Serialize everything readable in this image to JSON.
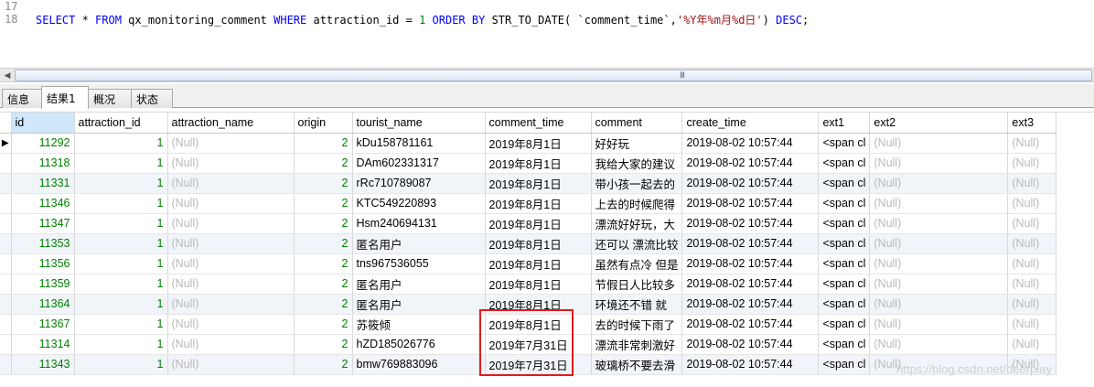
{
  "editor": {
    "line_numbers": [
      "17",
      "18"
    ],
    "sql": {
      "kw_select": "SELECT",
      "star": " * ",
      "kw_from": "FROM",
      "table": " qx_monitoring_comment ",
      "kw_where": "WHERE",
      "cond": " attraction_id = ",
      "value": "1",
      "kw_order": " ORDER BY ",
      "func": "STR_TO_DATE( `comment_time`,",
      "fmt": "'%Y年%m月%d日'",
      "close": ") ",
      "kw_desc": "DESC",
      "semicolon": ";"
    }
  },
  "scrollbar": {
    "grip": "III"
  },
  "tabs": [
    "信息",
    "结果1",
    "概况",
    "状态"
  ],
  "grid": {
    "columns": [
      "id",
      "attraction_id",
      "attraction_name",
      "origin",
      "tourist_name",
      "comment_time",
      "comment",
      "create_time",
      "ext1",
      "ext2",
      "ext3"
    ],
    "rows": [
      [
        "11292",
        "1",
        "(Null)",
        "2",
        "kDu158781161",
        "2019年8月1日",
        "好好玩",
        "2019-08-02 10:57:44",
        "<span cl",
        "(Null)",
        "(Null)"
      ],
      [
        "11318",
        "1",
        "(Null)",
        "2",
        "DAm602331317",
        "2019年8月1日",
        "我给大家的建议",
        "2019-08-02 10:57:44",
        "<span cl",
        "(Null)",
        "(Null)"
      ],
      [
        "11331",
        "1",
        "(Null)",
        "2",
        "rRc710789087",
        "2019年8月1日",
        "带小孩一起去的",
        "2019-08-02 10:57:44",
        "<span cl",
        "(Null)",
        "(Null)"
      ],
      [
        "11346",
        "1",
        "(Null)",
        "2",
        "KTC549220893",
        "2019年8月1日",
        "上去的时候爬得",
        "2019-08-02 10:57:44",
        "<span cl",
        "(Null)",
        "(Null)"
      ],
      [
        "11347",
        "1",
        "(Null)",
        "2",
        "Hsm240694131",
        "2019年8月1日",
        "漂流好好玩，大",
        "2019-08-02 10:57:44",
        "<span cl",
        "(Null)",
        "(Null)"
      ],
      [
        "11353",
        "1",
        "(Null)",
        "2",
        "匿名用户",
        "2019年8月1日",
        "还可以 漂流比较",
        "2019-08-02 10:57:44",
        "<span cl",
        "(Null)",
        "(Null)"
      ],
      [
        "11356",
        "1",
        "(Null)",
        "2",
        "tns967536055",
        "2019年8月1日",
        "虽然有点冷 但是",
        "2019-08-02 10:57:44",
        "<span cl",
        "(Null)",
        "(Null)"
      ],
      [
        "11359",
        "1",
        "(Null)",
        "2",
        "匿名用户",
        "2019年8月1日",
        "节假日人比较多",
        "2019-08-02 10:57:44",
        "<span cl",
        "(Null)",
        "(Null)"
      ],
      [
        "11364",
        "1",
        "(Null)",
        "2",
        "匿名用户",
        "2019年8月1日",
        "环境还不错   就",
        "2019-08-02 10:57:44",
        "<span cl",
        "(Null)",
        "(Null)"
      ],
      [
        "11367",
        "1",
        "(Null)",
        "2",
        "苏筱倾",
        "2019年8月1日",
        "去的时候下雨了",
        "2019-08-02 10:57:44",
        "<span cl",
        "(Null)",
        "(Null)"
      ],
      [
        "11314",
        "1",
        "(Null)",
        "2",
        "hZD185026776",
        "2019年7月31日",
        "漂流非常刺激好",
        "2019-08-02 10:57:44",
        "<span cl",
        "(Null)",
        "(Null)"
      ],
      [
        "11343",
        "1",
        "(Null)",
        "2",
        "bmw769883096",
        "2019年7月31日",
        "玻璃桥不要去滑",
        "2019-08-02 10:57:44",
        "<span cl",
        "(Null)",
        "(Null)"
      ]
    ]
  },
  "watermark": "https://blog.csdn.net/deerplay",
  "colors": {
    "highlight_box": "#e01b1b",
    "keyword": "#0000ff",
    "null_text": "#b9b9b9"
  }
}
